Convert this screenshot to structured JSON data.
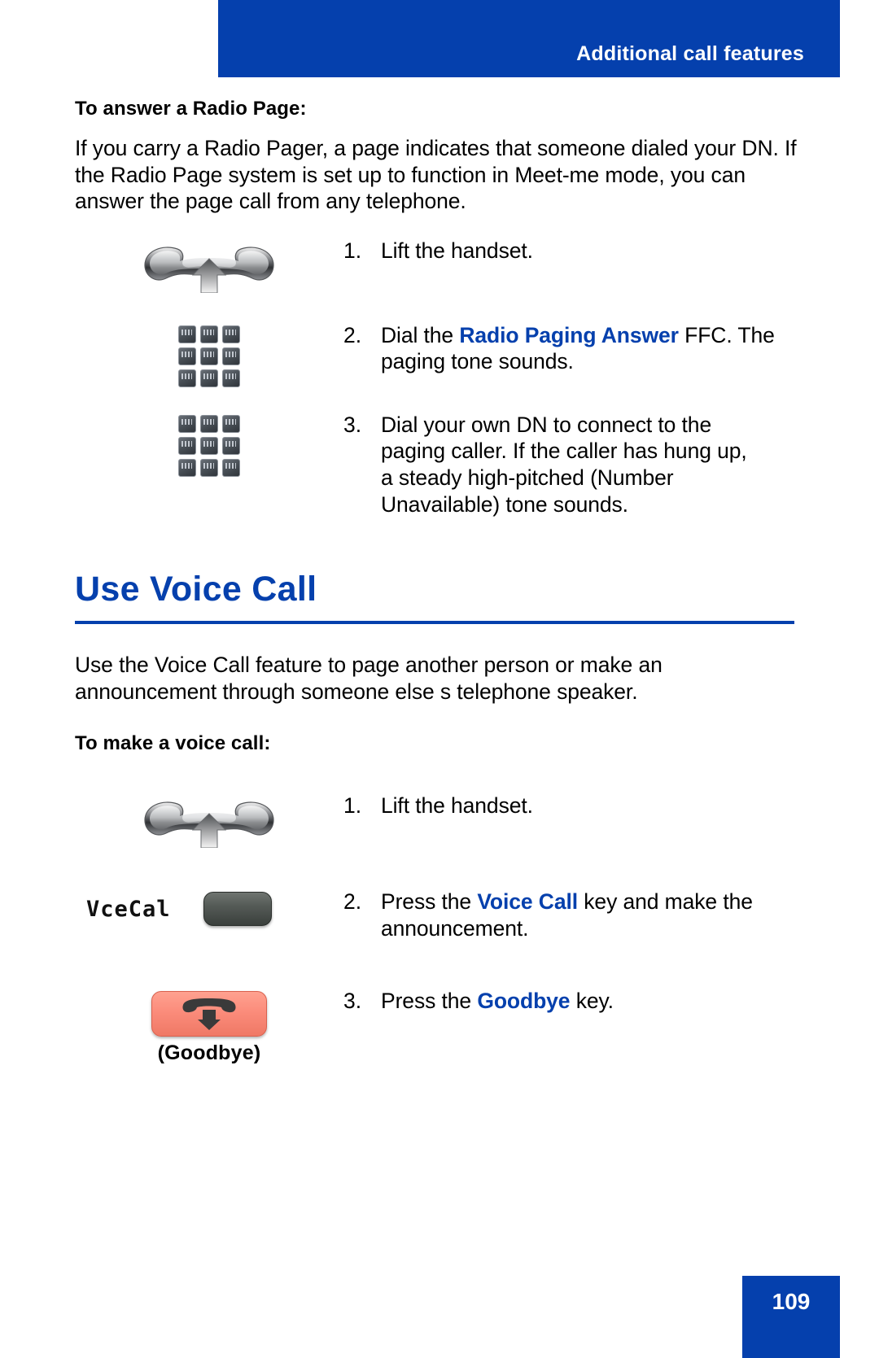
{
  "header": {
    "title": "Additional call features",
    "banner_color": "#0540ad"
  },
  "section_radio_page": {
    "subheading": "To answer a Radio Page:",
    "paragraph": "If you carry a Radio Pager, a page indicates that someone dialed your DN. If the Radio Page system is set up to function in Meet-me mode, you can answer the page call from any telephone.",
    "steps": [
      {
        "number": "1.",
        "icon": "handset-lift-icon",
        "text_parts": [
          {
            "text": "Lift the handset.",
            "style": "normal"
          }
        ]
      },
      {
        "number": "2.",
        "icon": "keypad-icon",
        "text_parts": [
          {
            "text": "Dial the ",
            "style": "normal"
          },
          {
            "text": "Radio Paging Answer",
            "style": "bluebold"
          },
          {
            "text": " FFC. The paging tone sounds.",
            "style": "normal"
          }
        ]
      },
      {
        "number": "3.",
        "icon": "keypad-icon",
        "text_parts": [
          {
            "text": "Dial your own DN to connect to the paging caller. If the caller has hung up, a steady high-pitched (Number Unavailable) tone sounds.",
            "style": "normal"
          }
        ]
      }
    ]
  },
  "section_voice_call": {
    "heading": "Use Voice Call",
    "heading_color": "#0540ad",
    "paragraph": "Use the Voice Call feature to page another person or make an announcement through someone else s telephone speaker.",
    "subheading": "To make a voice call:",
    "steps": [
      {
        "number": "1.",
        "icon": "handset-lift-icon",
        "text_parts": [
          {
            "text": "Lift the handset.",
            "style": "normal"
          }
        ]
      },
      {
        "number": "2.",
        "icon": "vcecal-softkey",
        "softkey_label": "VceCal",
        "text_parts": [
          {
            "text": "Press the ",
            "style": "normal"
          },
          {
            "text": "Voice Call",
            "style": "bluebold"
          },
          {
            "text": " key and make the announcement.",
            "style": "normal"
          }
        ]
      },
      {
        "number": "3.",
        "icon": "goodbye-key-icon",
        "key_caption": "(Goodbye)",
        "key_color": "#fb8c7b",
        "text_parts": [
          {
            "text": "Press the ",
            "style": "normal"
          },
          {
            "text": "Goodbye",
            "style": "bluebold"
          },
          {
            "text": " key.",
            "style": "normal"
          }
        ]
      }
    ]
  },
  "footer": {
    "page_number": "109"
  }
}
